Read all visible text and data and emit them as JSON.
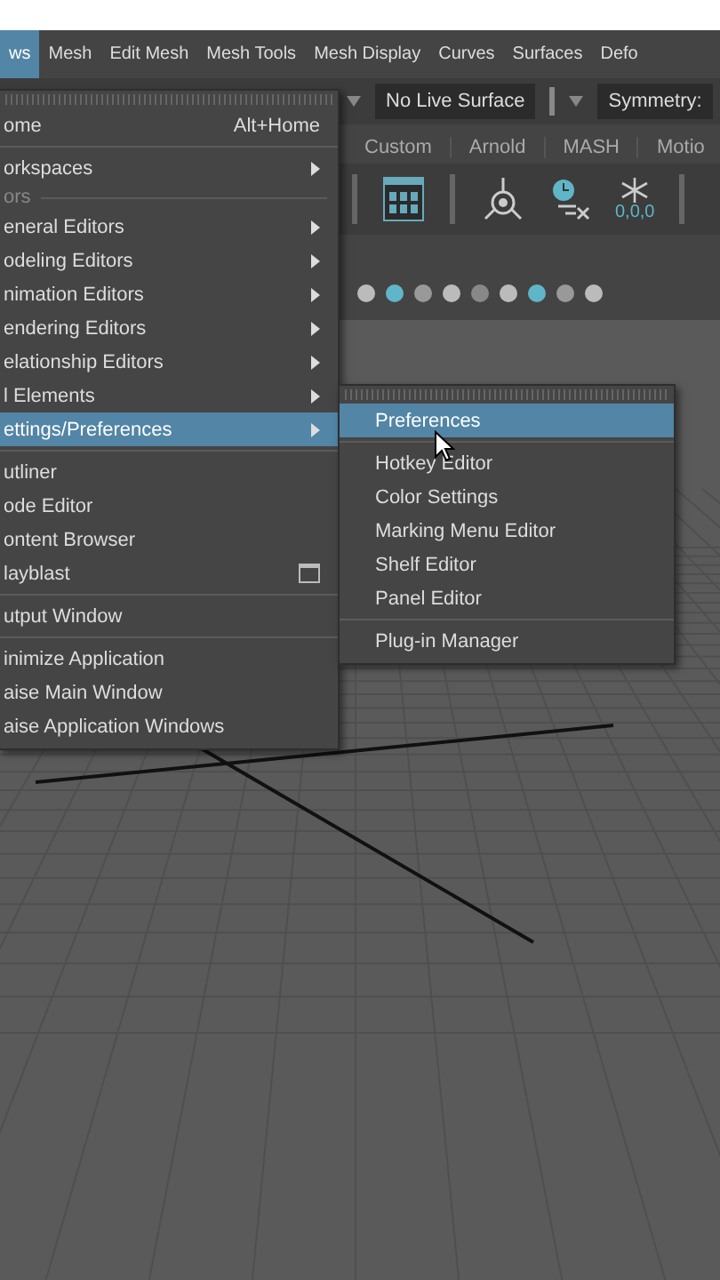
{
  "menubar": [
    {
      "label": "ws",
      "selected": true
    },
    {
      "label": "Mesh",
      "selected": false
    },
    {
      "label": "Edit Mesh",
      "selected": false
    },
    {
      "label": "Mesh Tools",
      "selected": false
    },
    {
      "label": "Mesh Display",
      "selected": false
    },
    {
      "label": "Curves",
      "selected": false
    },
    {
      "label": "Surfaces",
      "selected": false
    },
    {
      "label": "Defo",
      "selected": false
    }
  ],
  "toolbar": {
    "live_surface": "No Live Surface",
    "symmetry": "Symmetry:"
  },
  "shelf_tabs": [
    "Custom",
    "Arnold",
    "MASH",
    "Motio"
  ],
  "shelf": {
    "coord_label": "0,0,0"
  },
  "menu": [
    {
      "kind": "item",
      "label": "ome",
      "shortcut": "Alt+Home",
      "selected": false
    },
    {
      "kind": "divider"
    },
    {
      "kind": "submenu",
      "label": "orkspaces",
      "selected": false
    },
    {
      "kind": "section",
      "label": "ors"
    },
    {
      "kind": "submenu",
      "label": "eneral Editors",
      "selected": false
    },
    {
      "kind": "submenu",
      "label": "odeling Editors",
      "selected": false
    },
    {
      "kind": "submenu",
      "label": "nimation Editors",
      "selected": false
    },
    {
      "kind": "submenu",
      "label": "endering Editors",
      "selected": false
    },
    {
      "kind": "submenu",
      "label": "elationship Editors",
      "selected": false
    },
    {
      "kind": "submenu",
      "label": "l Elements",
      "selected": false
    },
    {
      "kind": "submenu",
      "label": "ettings/Preferences",
      "selected": true
    },
    {
      "kind": "divider"
    },
    {
      "kind": "item",
      "label": "utliner",
      "selected": false
    },
    {
      "kind": "item",
      "label": "ode Editor",
      "selected": false
    },
    {
      "kind": "item",
      "label": "ontent Browser",
      "selected": false
    },
    {
      "kind": "option",
      "label": "layblast",
      "selected": false
    },
    {
      "kind": "divider"
    },
    {
      "kind": "item",
      "label": "utput Window",
      "selected": false
    },
    {
      "kind": "divider"
    },
    {
      "kind": "item",
      "label": "inimize Application",
      "selected": false
    },
    {
      "kind": "item",
      "label": "aise Main Window",
      "selected": false
    },
    {
      "kind": "item",
      "label": "aise Application Windows",
      "selected": false
    }
  ],
  "submenu": [
    {
      "kind": "item",
      "label": "Preferences",
      "selected": true
    },
    {
      "kind": "divider"
    },
    {
      "kind": "item",
      "label": "Hotkey Editor",
      "selected": false
    },
    {
      "kind": "item",
      "label": "Color Settings",
      "selected": false
    },
    {
      "kind": "item",
      "label": "Marking Menu Editor",
      "selected": false
    },
    {
      "kind": "item",
      "label": "Shelf Editor",
      "selected": false
    },
    {
      "kind": "item",
      "label": "Panel Editor",
      "selected": false
    },
    {
      "kind": "divider"
    },
    {
      "kind": "item",
      "label": "Plug-in Manager",
      "selected": false
    }
  ]
}
